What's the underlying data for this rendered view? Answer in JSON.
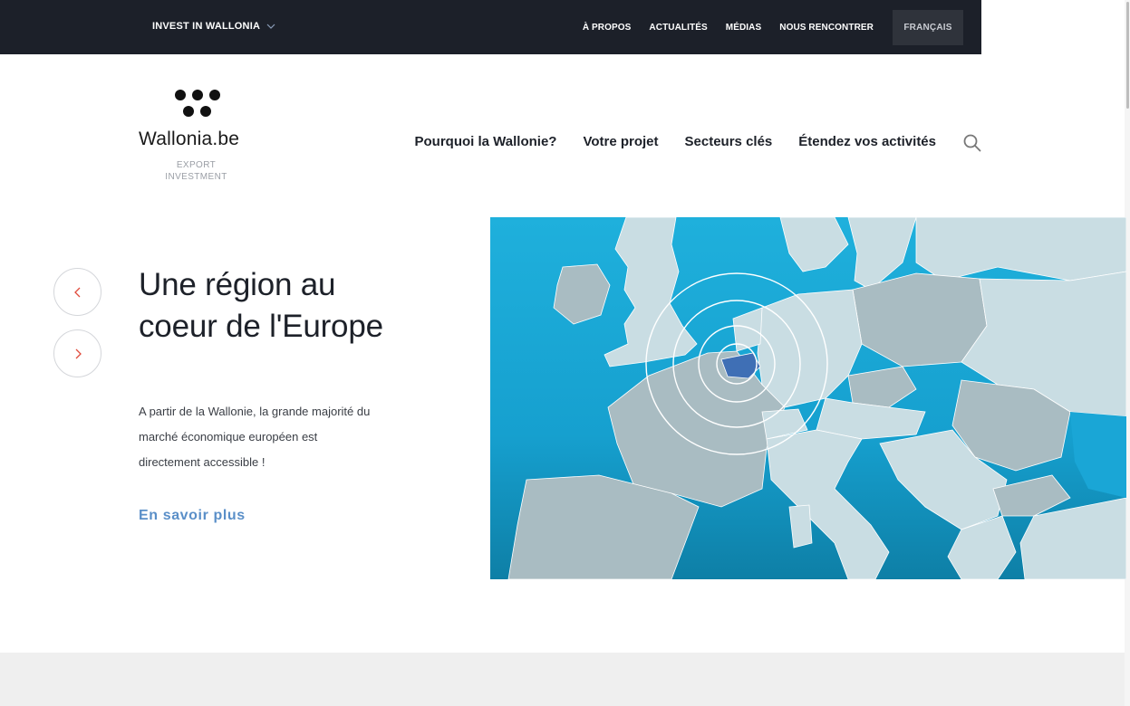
{
  "topbar": {
    "brand": "INVEST IN WALLONIA",
    "links": [
      "À PROPOS",
      "ACTUALITÉS",
      "MÉDIAS",
      "NOUS RENCONTRER"
    ],
    "language": "FRANÇAIS"
  },
  "logo": {
    "name": "Wallonia",
    "tld": ".be",
    "sub1": "EXPORT",
    "sub2": "INVESTMENT"
  },
  "nav": {
    "items": [
      "Pourquoi la Wallonie?",
      "Votre projet",
      "Secteurs clés",
      "Étendez vos activités"
    ]
  },
  "slide": {
    "title_line1": "Une région au",
    "title_line2": "coeur de l'Europe",
    "text_line1": "A partir de la Wallonie, la grande majorité du",
    "text_line2": "marché économique européen est",
    "text_line3": "directement accessible !",
    "link": "En savoir plus"
  },
  "colors": {
    "topbar_bg": "#1c2029",
    "accent_link": "#5a8fc8",
    "arrow": "#e04b3c",
    "sea": "#1aa6d6",
    "land": "#c9dde3",
    "land_dark": "#a9bcc2",
    "wallonia": "#3f6fb5"
  },
  "icons": {
    "prev": "chevron-left-icon",
    "next": "chevron-right-icon",
    "search": "search-icon",
    "dropdown": "chevron-down-icon"
  }
}
